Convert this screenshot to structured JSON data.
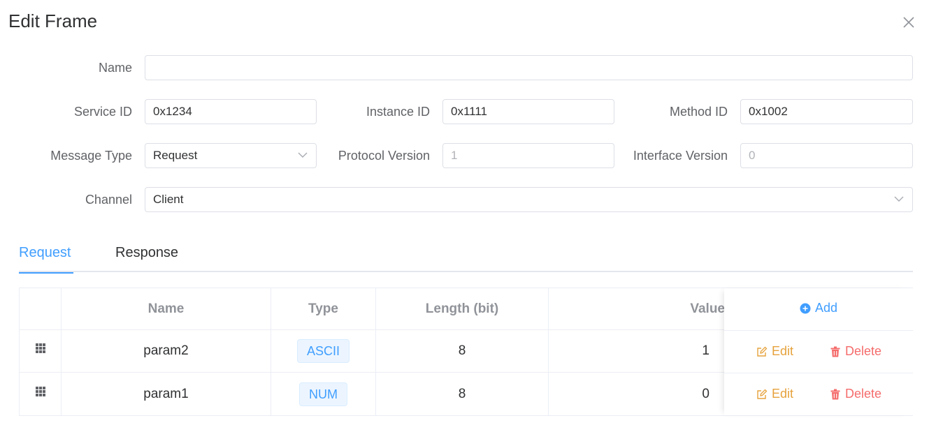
{
  "dialog": {
    "title": "Edit Frame",
    "close_icon": "close-icon"
  },
  "form": {
    "name": {
      "label": "Name",
      "value": ""
    },
    "service_id": {
      "label": "Service ID",
      "value": "0x1234"
    },
    "instance_id": {
      "label": "Instance ID",
      "value": "0x1111"
    },
    "method_id": {
      "label": "Method ID",
      "value": "0x1002"
    },
    "message_type": {
      "label": "Message Type",
      "value": "Request"
    },
    "protocol_version": {
      "label": "Protocol Version",
      "placeholder": "1"
    },
    "interface_version": {
      "label": "Interface Version",
      "placeholder": "0"
    },
    "channel": {
      "label": "Channel",
      "value": "Client"
    }
  },
  "tabs": [
    {
      "label": "Request",
      "active": true
    },
    {
      "label": "Response",
      "active": false
    }
  ],
  "table": {
    "headers": {
      "name": "Name",
      "type": "Type",
      "length": "Length (bit)",
      "value": "Value",
      "add": "Add"
    },
    "rows": [
      {
        "name": "param2",
        "type": "ASCII",
        "length": "8",
        "value": "1",
        "edit": "Edit",
        "delete": "Delete"
      },
      {
        "name": "param1",
        "type": "NUM",
        "length": "8",
        "value": "0",
        "edit": "Edit",
        "delete": "Delete"
      }
    ]
  },
  "colors": {
    "primary": "#409eff",
    "warning": "#e6a23c",
    "danger": "#f56c6c"
  }
}
